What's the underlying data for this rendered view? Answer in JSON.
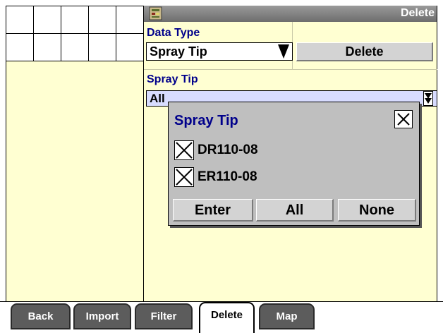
{
  "titlebar": {
    "title": "Delete",
    "icon": "document-icon"
  },
  "data_type": {
    "label": "Data Type",
    "value": "Spray Tip",
    "delete_button": "Delete"
  },
  "spray_tip": {
    "label": "Spray Tip",
    "value": "All"
  },
  "popup": {
    "title": "Spray Tip",
    "items": [
      {
        "label": "DR110-08",
        "checked": true
      },
      {
        "label": "ER110-08",
        "checked": true
      }
    ],
    "buttons": {
      "enter": "Enter",
      "all": "All",
      "none": "None"
    }
  },
  "tabs": [
    {
      "label": "Back",
      "active": false
    },
    {
      "label": "Import",
      "active": false
    },
    {
      "label": "Filter",
      "active": false
    },
    {
      "label": "Delete",
      "active": true
    },
    {
      "label": "Map",
      "active": false
    }
  ],
  "colors": {
    "pane_background": "#FFFFD2",
    "label_color": "#00008B",
    "dropdown_highlight": "#D8DCFF",
    "popup_background": "#BFBFBF",
    "tab_inactive": "#5C5C5C"
  }
}
